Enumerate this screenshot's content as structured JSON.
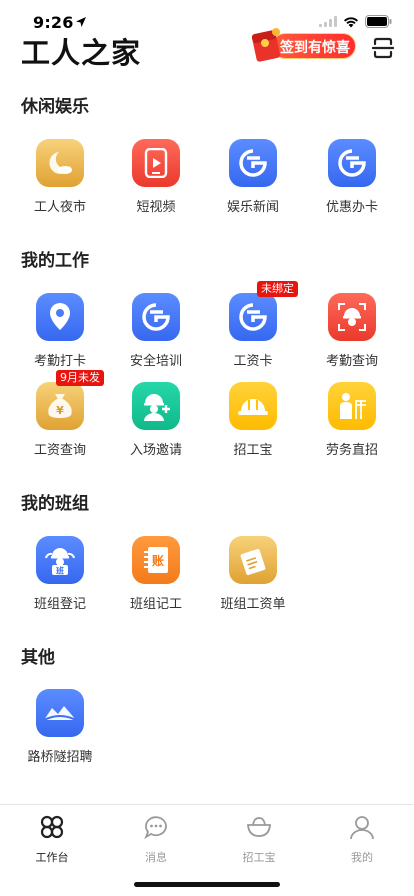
{
  "status": {
    "time": "9:26"
  },
  "header": {
    "title": "工人之家",
    "checkin_label": "签到有惊喜"
  },
  "sections": {
    "leisure": {
      "title": "休闲娱乐",
      "items": [
        {
          "label": "工人夜市",
          "icon": "night-market-icon"
        },
        {
          "label": "短视频",
          "icon": "short-video-icon"
        },
        {
          "label": "娱乐新闻",
          "icon": "entertainment-news-icon"
        },
        {
          "label": "优惠办卡",
          "icon": "discount-card-icon"
        }
      ]
    },
    "work": {
      "title": "我的工作",
      "items": [
        {
          "label": "考勤打卡",
          "icon": "location-pin-icon"
        },
        {
          "label": "安全培训",
          "icon": "safety-training-icon"
        },
        {
          "label": "工资卡",
          "icon": "salary-card-icon",
          "tag": "未绑定"
        },
        {
          "label": "考勤查询",
          "icon": "attendance-query-icon"
        },
        {
          "label": "工资查询",
          "icon": "money-bag-icon",
          "tag": "9月未发",
          "glyph": "¥"
        },
        {
          "label": "入场邀请",
          "icon": "invite-worker-icon"
        },
        {
          "label": "招工宝",
          "icon": "hardhat-icon"
        },
        {
          "label": "劳务直招",
          "icon": "recruit-icon"
        }
      ]
    },
    "team": {
      "title": "我的班组",
      "items": [
        {
          "label": "班组登记",
          "icon": "team-register-icon",
          "glyph": "班"
        },
        {
          "label": "班组记工",
          "icon": "ledger-icon",
          "glyph": "账"
        },
        {
          "label": "班组工资单",
          "icon": "payroll-icon"
        }
      ]
    },
    "other": {
      "title": "其他",
      "items": [
        {
          "label": "路桥隧招聘",
          "icon": "bridge-icon"
        }
      ]
    }
  },
  "tabbar": {
    "items": [
      {
        "label": "工作台",
        "icon": "workbench-icon"
      },
      {
        "label": "消息",
        "icon": "message-icon"
      },
      {
        "label": "招工宝",
        "icon": "ingot-icon"
      },
      {
        "label": "我的",
        "icon": "profile-icon"
      }
    ]
  }
}
